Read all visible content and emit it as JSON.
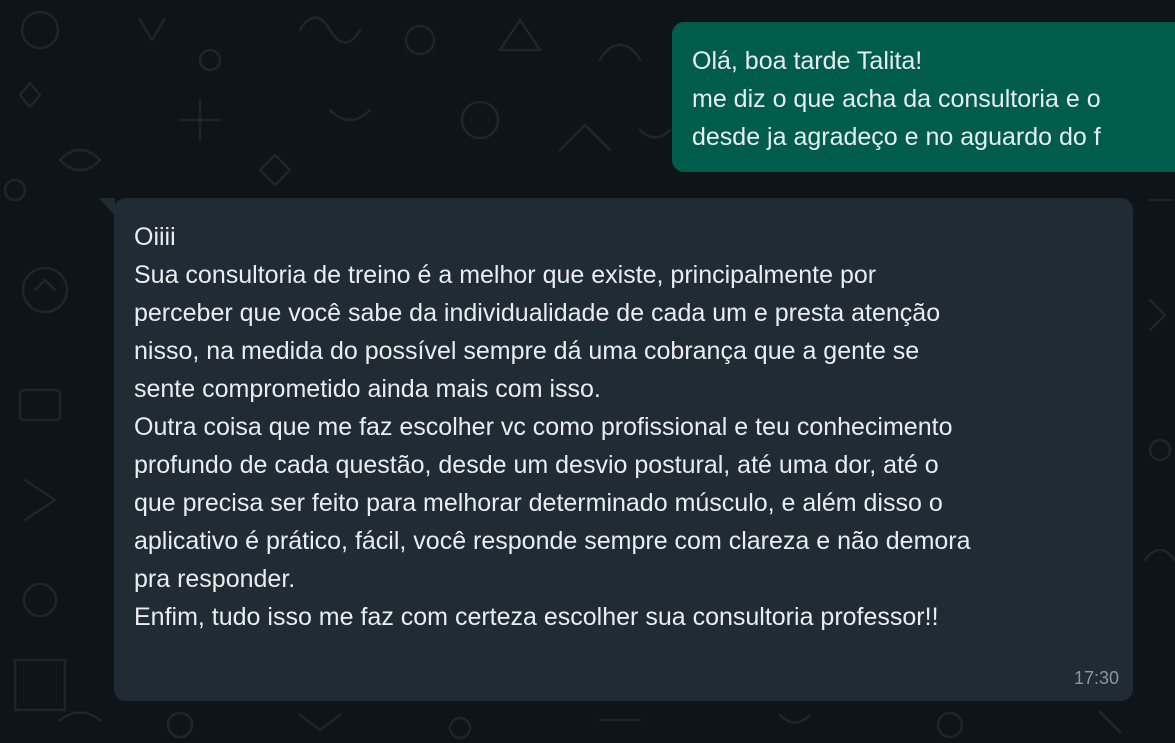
{
  "outgoing": {
    "lines": [
      "Olá, boa tarde Talita!",
      "me diz o que acha da consultoria e o",
      "desde ja agradeço e no aguardo do f"
    ]
  },
  "incoming": {
    "lines": [
      "Oiiii",
      "Sua consultoria de treino é a melhor que existe, principalmente por",
      "perceber que você sabe da individualidade de cada um e presta atenção",
      "nisso, na medida do possível sempre dá uma cobrança que a gente se",
      "sente comprometido ainda mais com isso.",
      "Outra coisa que me faz escolher vc como profissional e teu conhecimento",
      "profundo de cada questão, desde um desvio postural, até uma dor, até o",
      "que precisa ser feito para melhorar determinado músculo, e além disso o",
      "aplicativo é prático, fácil, você responde sempre com clareza e não demora",
      "pra responder.",
      "Enfim, tudo isso me faz com certeza escolher sua consultoria professor!!"
    ],
    "time": "17:30"
  },
  "colors": {
    "background": "#0e1519",
    "outgoing_bubble": "#005c4b",
    "incoming_bubble": "#202c33",
    "text": "#e9edef",
    "timestamp": "#8696a0"
  },
  "icons": [
    "doodle-wallpaper"
  ]
}
